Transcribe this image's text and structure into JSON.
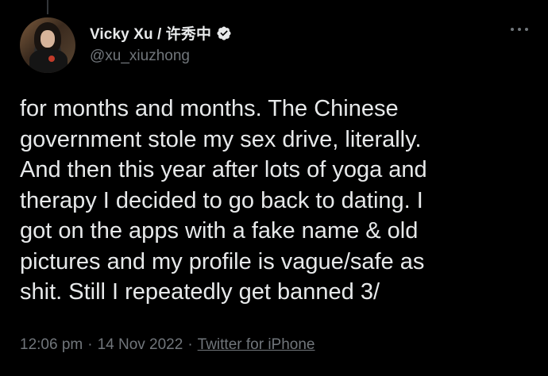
{
  "tweet": {
    "author": {
      "display_name": "Vicky Xu / 许秀中",
      "handle": "@xu_xiuzhong",
      "verified": true
    },
    "text": "for months and months. The Chinese\ngovernment stole my sex drive, literally.\nAnd then this year after lots of yoga and\ntherapy I decided to go back to dating. I\ngot on the apps with a fake name & old\npictures and my profile is vague/safe as\nshit. Still I repeatedly get banned 3/",
    "time": "12:06 pm",
    "date": "14 Nov 2022",
    "separator": "·",
    "source": "Twitter for iPhone"
  },
  "colors": {
    "background": "#000000",
    "text": "#e7e9ea",
    "secondary": "#71767b",
    "verified": "#1d9bf0"
  },
  "icons": {
    "verified": "verified-badge-icon",
    "more": "more-options-icon"
  }
}
